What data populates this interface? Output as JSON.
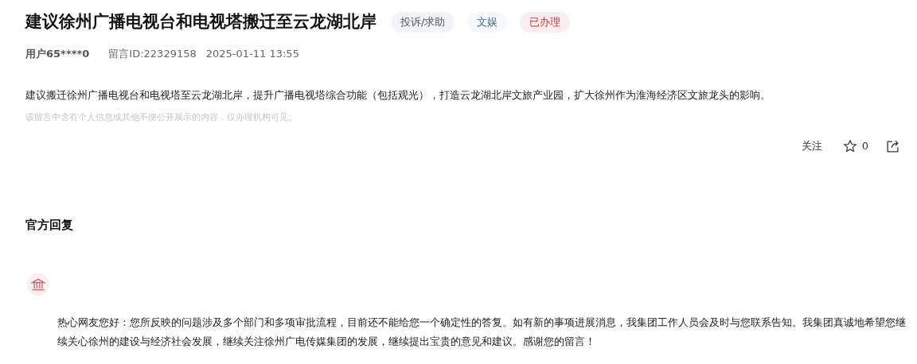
{
  "title": "建议徐州广播电视台和电视塔搬迁至云龙湖北岸",
  "tags": [
    {
      "label": "投诉/求助",
      "kind": "type"
    },
    {
      "label": "文娱",
      "kind": "category"
    },
    {
      "label": "已办理",
      "kind": "status"
    }
  ],
  "meta": {
    "user": "用户65****0",
    "message_id": "留言ID:22329158",
    "time": "2025-01-11 13:55"
  },
  "content": "建议搬迁徐州广播电视台和电视塔至云龙湖北岸，提升广播电视塔综合功能（包括观光），打造云龙湖北岸文旅产业园，扩大徐州作为淮海经济区文旅龙头的影响。",
  "notice": "该留言中含有个人信息或其他不便公开展示的内容，仅办理机构可见。",
  "actions": {
    "follow": "关注",
    "star_count": "0"
  },
  "reply": {
    "heading": "官方回复",
    "text": "热心网友您好：您所反映的问题涉及多个部门和多项审批流程，目前还不能给您一个确定性的答复。如有新的事项进展消息，我集团工作人员会及时与您联系告知。我集团真诚地希望您继续关心徐州的建设与经济社会发展，继续关注徐州广电传媒集团的发展，继续提出宝贵的意见和建议。感谢您的留言！"
  }
}
